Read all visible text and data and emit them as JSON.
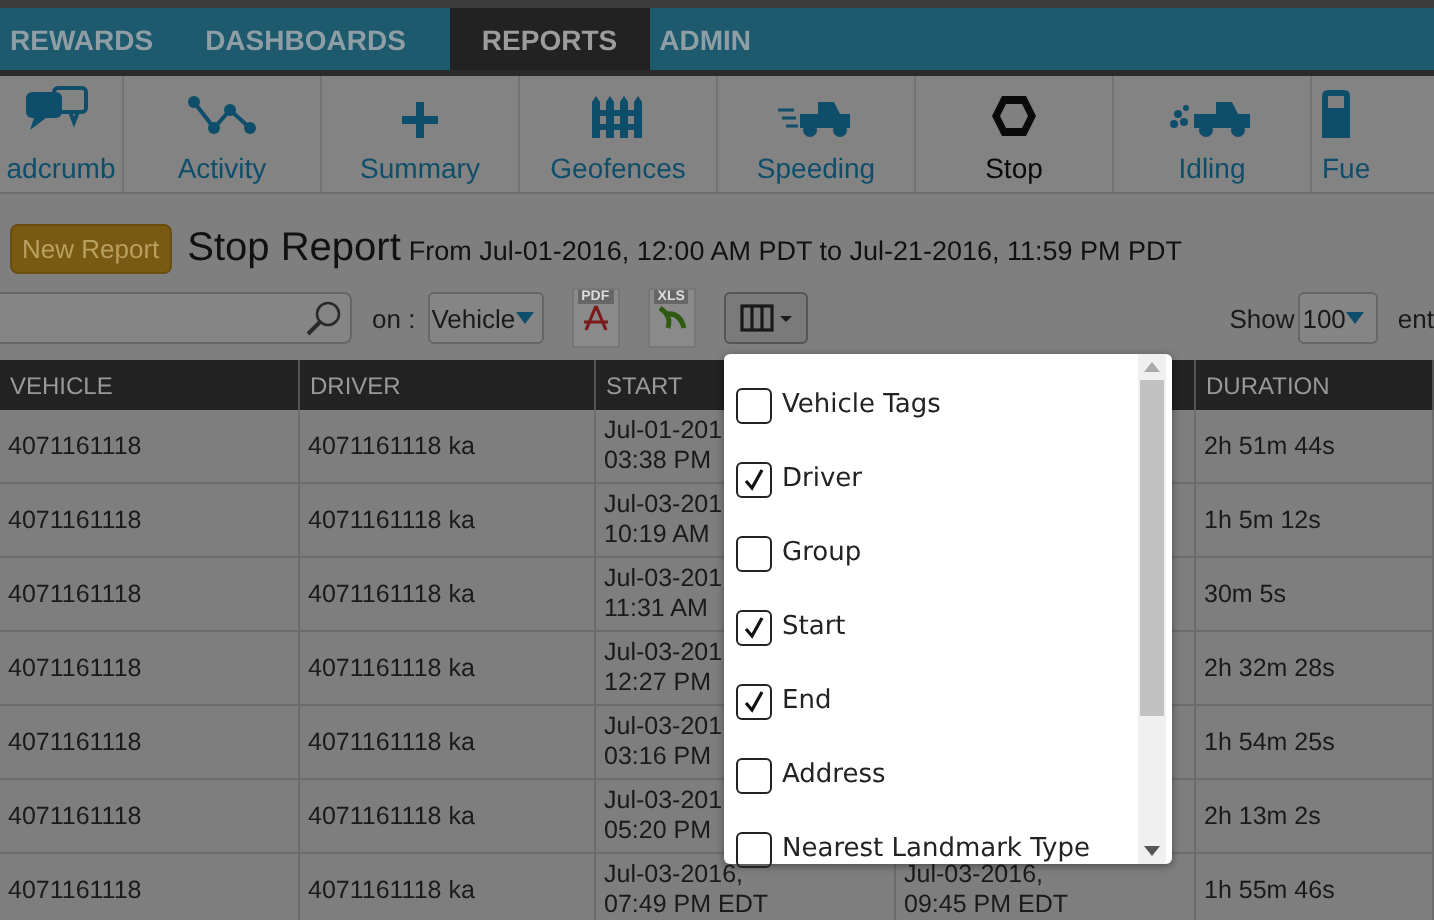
{
  "nav_tabs": [
    {
      "label": "REWARDS",
      "selected": false
    },
    {
      "label": "DASHBOARDS",
      "selected": false
    },
    {
      "label": "REPORTS",
      "selected": true
    },
    {
      "label": "ADMIN",
      "selected": false
    }
  ],
  "report_types": [
    {
      "label": "adcrumb",
      "kind": "breadcrumb",
      "selected": false
    },
    {
      "label": "Activity",
      "kind": "activity",
      "selected": false
    },
    {
      "label": "Summary",
      "kind": "summary",
      "selected": false
    },
    {
      "label": "Geofences",
      "kind": "geofence",
      "selected": false
    },
    {
      "label": "Speeding",
      "kind": "speeding",
      "selected": false
    },
    {
      "label": "Stop",
      "kind": "stop",
      "selected": true
    },
    {
      "label": "Idling",
      "kind": "idling",
      "selected": false
    },
    {
      "label": "Fue",
      "kind": "fuel",
      "selected": false
    }
  ],
  "header": {
    "new_report_button": "New Report",
    "title": "Stop Report",
    "range": "From Jul-01-2016, 12:00 AM PDT to Jul-21-2016, 11:59 PM PDT"
  },
  "filter": {
    "on_label": "on :",
    "field": "Vehicle"
  },
  "exports": [
    {
      "kind": "pdf",
      "label": "PDF"
    },
    {
      "kind": "xls",
      "label": "XLS"
    }
  ],
  "show": {
    "label": "Show",
    "value": "100",
    "suffix": "ent"
  },
  "columns": [
    "VEHICLE",
    "DRIVER",
    "START",
    "DURATION"
  ],
  "rows": [
    {
      "vehicle": "4071161118",
      "driver": "4071161118 ka",
      "start": [
        "Jul-01-201",
        "03:38 PM"
      ],
      "duration": "2h 51m 44s"
    },
    {
      "vehicle": "4071161118",
      "driver": "4071161118 ka",
      "start": [
        "Jul-03-201",
        "10:19 AM"
      ],
      "duration": "1h 5m 12s"
    },
    {
      "vehicle": "4071161118",
      "driver": "4071161118 ka",
      "start": [
        "Jul-03-201",
        "11:31 AM"
      ],
      "duration": "30m 5s"
    },
    {
      "vehicle": "4071161118",
      "driver": "4071161118 ka",
      "start": [
        "Jul-03-201",
        "12:27 PM"
      ],
      "duration": "2h 32m 28s"
    },
    {
      "vehicle": "4071161118",
      "driver": "4071161118 ka",
      "start": [
        "Jul-03-201",
        "03:16 PM"
      ],
      "duration": "1h 54m 25s"
    },
    {
      "vehicle": "4071161118",
      "driver": "4071161118 ka",
      "start": [
        "Jul-03-201",
        "05:20 PM"
      ],
      "duration": "2h 13m 2s"
    },
    {
      "vehicle": "4071161118",
      "driver": "4071161118 ka",
      "start": [
        "Jul-03-2016,",
        "07:49 PM EDT"
      ],
      "end": [
        "Jul-03-2016,",
        "09:45 PM EDT"
      ],
      "duration": "1h 55m 46s"
    }
  ],
  "column_menu": [
    {
      "label": "Vehicle Tags",
      "checked": false
    },
    {
      "label": "Driver",
      "checked": true
    },
    {
      "label": "Group",
      "checked": false
    },
    {
      "label": "Start",
      "checked": true
    },
    {
      "label": "End",
      "checked": true
    },
    {
      "label": "Address",
      "checked": false
    },
    {
      "label": "Nearest Landmark Type",
      "checked": false
    }
  ]
}
